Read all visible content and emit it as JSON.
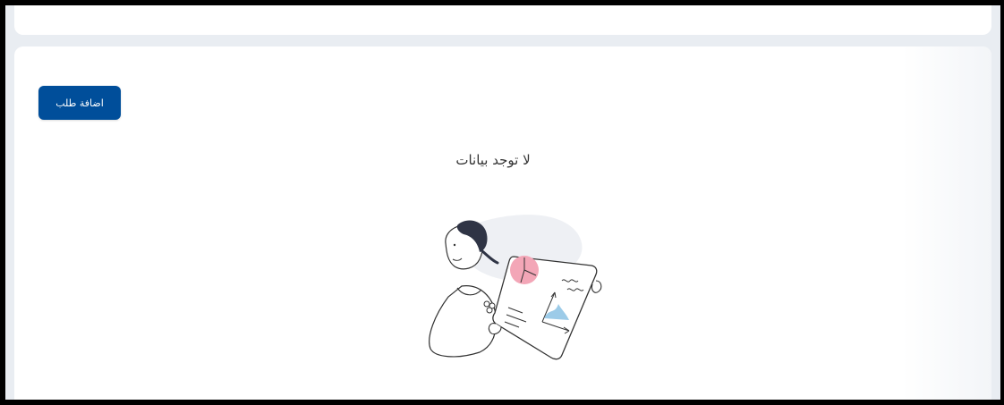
{
  "toolbar": {
    "add_request_label": "اضافة طلب"
  },
  "empty_state": {
    "message": "لا توجد بيانات",
    "illustration_icon": "person-holding-chart-illustration"
  },
  "colors": {
    "primary": "#004e9a",
    "background": "#e9edf2",
    "card": "#ffffff",
    "accent_pink": "#f3a6b7",
    "accent_blue": "#9ccbe8"
  }
}
